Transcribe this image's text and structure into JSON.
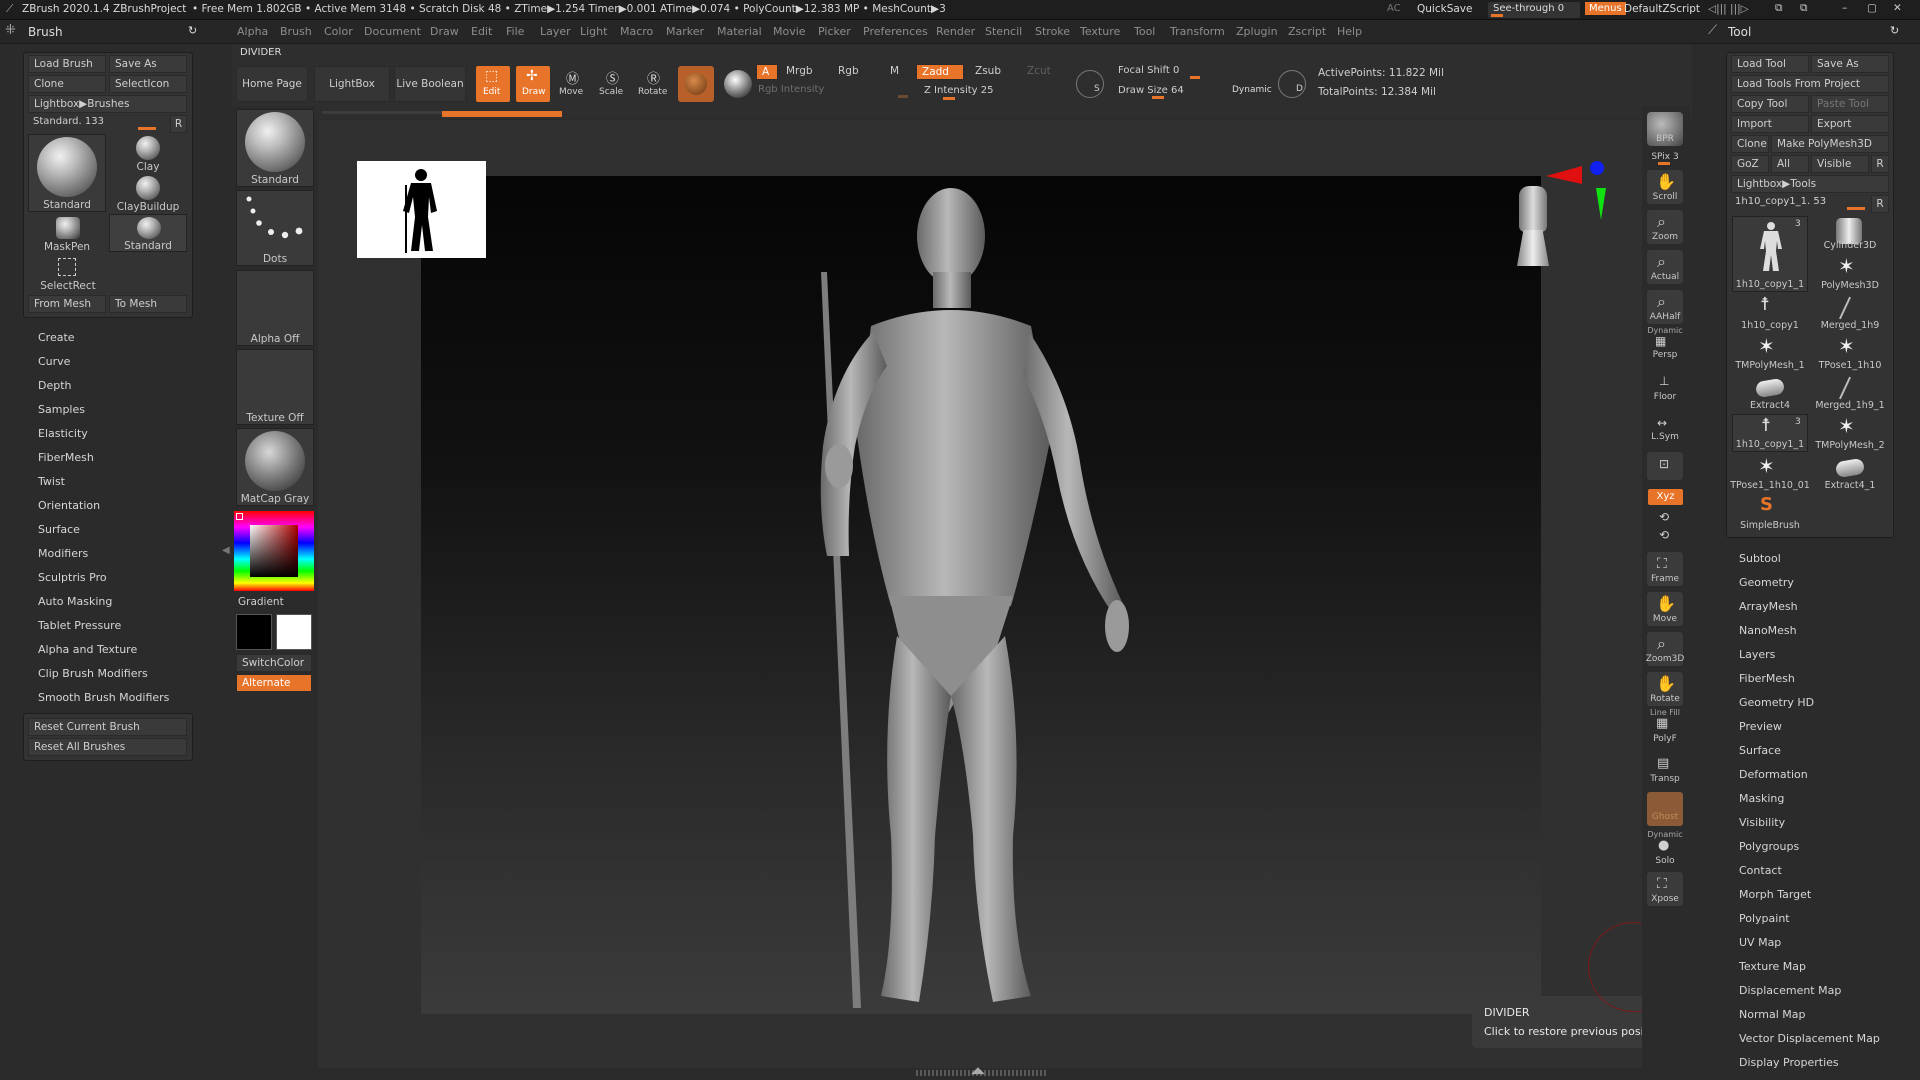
{
  "titlebar": {
    "app": "ZBrush 2020.1.4",
    "project": "ZBrushProject",
    "status": "• Free Mem 1.802GB • Active Mem 3148 • Scratch Disk 48 • ZTime▶1.254 Timer▶0.001 ATime▶0.074 • PolyCount▶12.383 MP • MeshCount▶3",
    "ac": "AC",
    "quicksave": "QuickSave",
    "see_through": "See-through   0",
    "menus": "Menus",
    "default_zscript": "DefaultZScript"
  },
  "menubar": [
    "Alpha",
    "Brush",
    "Color",
    "Document",
    "Draw",
    "Edit",
    "File",
    "Layer",
    "Light",
    "Macro",
    "Marker",
    "Material",
    "Movie",
    "Picker",
    "Preferences",
    "Render",
    "Stencil",
    "Stroke",
    "Texture",
    "Tool",
    "Transform",
    "Zplugin",
    "Zscript",
    "Help"
  ],
  "brush_panel": {
    "title": "Brush",
    "load_brush": "Load Brush",
    "save_as": "Save As",
    "clone": "Clone",
    "select_icon": "SelectIcon",
    "lightbox_brushes": "Lightbox▶Brushes",
    "slider": "Standard.  133",
    "r": "R",
    "brushes": {
      "standard_main": "Standard",
      "clay": "Clay",
      "claybuildup": "ClayBuildup",
      "maskpen": "MaskPen",
      "standard_small": "Standard",
      "selectrect": "SelectRect"
    },
    "from_mesh": "From Mesh",
    "to_mesh": "To Mesh",
    "menu": [
      "Create",
      "Curve",
      "Depth",
      "Samples",
      "Elasticity",
      "FiberMesh",
      "Twist",
      "Orientation",
      "Surface",
      "Modifiers",
      "Sculptris Pro",
      "Auto Masking",
      "Tablet Pressure",
      "Alpha and Texture",
      "Clip Brush Modifiers",
      "Smooth Brush Modifiers"
    ],
    "reset_current": "Reset Current Brush",
    "reset_all": "Reset All Brushes"
  },
  "top_shelf": {
    "divider": "DIVIDER",
    "home_page": "Home Page",
    "lightbox": "LightBox",
    "live_boolean": "Live Boolean",
    "edit": "Edit",
    "draw": "Draw",
    "move": "Move",
    "scale": "Scale",
    "rotate": "Rotate",
    "a": "A",
    "mrgb": "Mrgb",
    "rgb": "Rgb",
    "m": "M",
    "rgb_intensity": "Rgb Intensity",
    "zadd": "Zadd",
    "zsub": "Zsub",
    "zcut": "Zcut",
    "z_intensity": "Z Intensity 25",
    "z_intensity_value": 25,
    "focal_shift": "Focal Shift 0",
    "draw_size": "Draw Size  64",
    "dynamic": "Dynamic",
    "active_points": "ActivePoints: 11.822  Mil",
    "total_points": "TotalPoints: 12.384  Mil",
    "s_label": "S",
    "d_label": "D"
  },
  "left_shelf": {
    "standard": "Standard",
    "dots": "Dots",
    "alpha_off": "Alpha Off",
    "texture_off": "Texture Off",
    "matcap": "MatCap Gray",
    "gradient": "Gradient",
    "switchcolor": "SwitchColor",
    "alternate": "Alternate"
  },
  "right_shelf": [
    "BPR",
    "Scroll",
    "Zoom",
    "Actual",
    "AAHalf",
    "Persp",
    "Floor",
    "L.Sym",
    "",
    "Frame",
    "Move",
    "Zoom3D",
    "Rotate",
    "PolyF",
    "Transp",
    "Ghost",
    "Solo",
    "Xpose"
  ],
  "right_shelf_extra": {
    "spix": "SPix 3",
    "dynamic": "Dynamic",
    "xyz": "Xyz",
    "line_fill": "Line Fill",
    "dynamic2": "Dynamic"
  },
  "tool_panel": {
    "title": "Tool",
    "load_tool": "Load Tool",
    "save_as": "Save As",
    "load_from_project": "Load Tools From Project",
    "copy_tool": "Copy Tool",
    "paste_tool": "Paste Tool",
    "import": "Import",
    "export": "Export",
    "clone": "Clone",
    "make_polymesh": "Make PolyMesh3D",
    "goz": "GoZ",
    "all": "All",
    "visible": "Visible",
    "r": "R",
    "lightbox_tools": "Lightbox▶Tools",
    "slider": "1h10_copy1_1.  53",
    "tools": [
      "1h10_copy1_1",
      "Cylinder3D",
      "PolyMesh3D",
      "1h10_copy1",
      "Merged_1h9",
      "TMPolyMesh_1",
      "TPose1_1h10",
      "Extract4",
      "Merged_1h9_1",
      "1h10_copy1_1",
      "TMPolyMesh_2",
      "TPose1_1h10_01",
      "Extract4_1",
      "SimpleBrush"
    ],
    "badge3": "3",
    "menu": [
      "Subtool",
      "Geometry",
      "ArrayMesh",
      "NanoMesh",
      "Layers",
      "FiberMesh",
      "Geometry HD",
      "Preview",
      "Surface",
      "Deformation",
      "Masking",
      "Visibility",
      "Polygroups",
      "Contact",
      "Morph Target",
      "Polypaint",
      "UV Map",
      "Texture Map",
      "Displacement Map",
      "Normal Map",
      "Vector Displacement Map",
      "Display Properties"
    ]
  },
  "tooltip": {
    "title": "DIVIDER",
    "text": "Click to restore previous position."
  },
  "colors": {
    "accent": "#e8742a",
    "panel": "#303030",
    "canvas_top": "#0a0a0a",
    "canvas_bottom": "#3a3a3a"
  }
}
